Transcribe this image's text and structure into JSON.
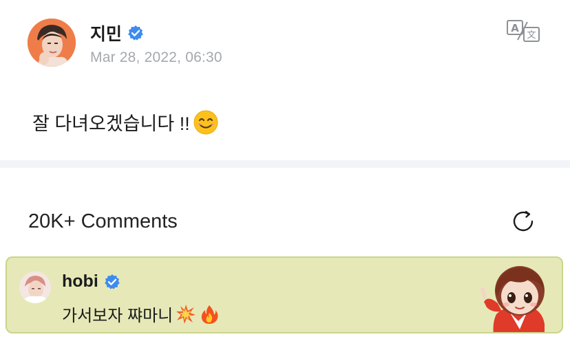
{
  "post": {
    "author": "지민",
    "verified": true,
    "timestamp": "Mar 28, 2022, 06:30",
    "text": "잘 다녀오겠습니다 !!",
    "emoji": "smiling-face-icon"
  },
  "comments": {
    "count_label": "20K+ Comments"
  },
  "highlighted_comment": {
    "author": "hobi",
    "verified": true,
    "text": "가서보자 쨔마니",
    "emojis": [
      "collision-icon",
      "fire-icon"
    ]
  },
  "colors": {
    "verified_blue": "#3d8bf2",
    "highlight_bg": "#e6e9b7",
    "timestamp_gray": "#a5a8ad",
    "divider": "#f3f4f8"
  }
}
